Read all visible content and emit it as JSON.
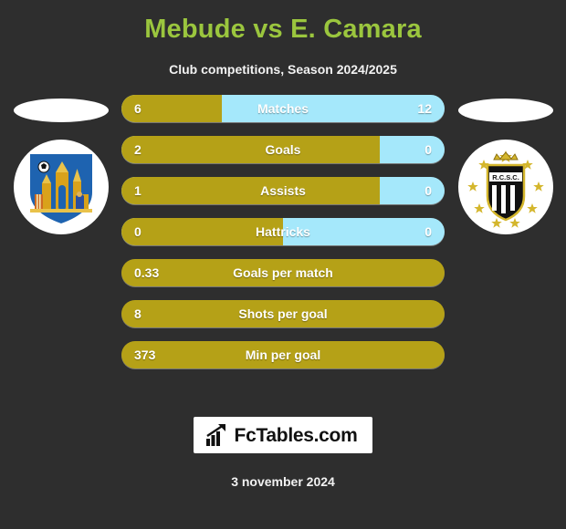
{
  "header": {
    "title": "Mebude vs E. Camara",
    "subtitle": "Club competitions, Season 2024/2025",
    "title_color": "#9bc63e"
  },
  "theme": {
    "background": "#2e2e2e",
    "home_color": "#b5a117",
    "away_color": "#a5e8fb",
    "text_color": "#ffffff"
  },
  "home": {
    "player_name": "Mebude",
    "club_badge": "club-brugge-badge",
    "player_photo": "player-photo-placeholder"
  },
  "away": {
    "player_name": "E. Camara",
    "club_badge": "rcsc-charleroi-badge",
    "player_photo": "player-photo-placeholder"
  },
  "stats": [
    {
      "label": "Matches",
      "home": "6",
      "away": "12",
      "home_pct": 31,
      "split": true
    },
    {
      "label": "Goals",
      "home": "2",
      "away": "0",
      "home_pct": 80,
      "split": true
    },
    {
      "label": "Assists",
      "home": "1",
      "away": "0",
      "home_pct": 80,
      "split": true
    },
    {
      "label": "Hattricks",
      "home": "0",
      "away": "0",
      "home_pct": 50,
      "split": true
    },
    {
      "label": "Goals per match",
      "home": "0.33",
      "away": "",
      "home_pct": 100,
      "split": false
    },
    {
      "label": "Shots per goal",
      "home": "8",
      "away": "",
      "home_pct": 100,
      "split": false
    },
    {
      "label": "Min per goal",
      "home": "373",
      "away": "",
      "home_pct": 100,
      "split": false
    }
  ],
  "footer": {
    "logo_text": "FcTables.com",
    "logo_icon": "bar-chart-arrow-icon",
    "date": "3 november 2024"
  }
}
